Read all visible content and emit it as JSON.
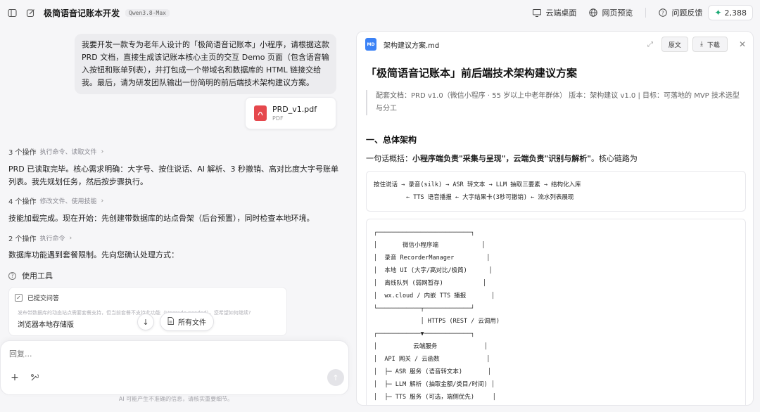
{
  "topbar": {
    "title": "极简语音记账本开发",
    "model": "Qwen3.8-Max",
    "actions": {
      "cloud_desktop": "云端桌面",
      "web_preview": "网页预览",
      "feedback": "问题反馈"
    },
    "credits": "2,388"
  },
  "chat": {
    "user_message": "我要开发一款专为老年人设计的「极简语音记账本」小程序，请根据这款 PRD 文档，直接生成该记账本核心主页的交互 Demo 页面（包含语音输入按钮和账单列表），并打包成一个带域名和数据库的 HTML 链接交给我。最后，请为研发团队输出一份简明的前后端技术架构建议方案。",
    "file": {
      "name": "PRD_v1.pdf",
      "type": "PDF"
    },
    "ops": [
      {
        "count": "3 个操作",
        "desc": "执行命令、读取文件"
      },
      {
        "count": "4 个操作",
        "desc": "修改文件、使用技能"
      },
      {
        "count": "2 个操作",
        "desc": "执行命令"
      }
    ],
    "replies": [
      "PRD 已读取完毕。核心需求明确：大字号、按住说话、AI 解析、3 秒撤销、高对比度大字号账单列表。我先规划任务，然后按步骤执行。",
      "技能加载完成。现在开始：先创建带数据库的站点骨架（后台预置），同时检查本地环境。",
      "数据库功能遇到套餐限制。先向您确认处理方式："
    ],
    "tool_label": "使用工具",
    "submitted": {
      "title": "已提交问答",
      "note": "发布带数据库的动态站点需要套餐支持，但当前套餐不支持此功能（Upgrade needed）。您希望如何继续?",
      "choice": "浏览器本地存储版"
    },
    "all_files": "所有文件",
    "composer_placeholder": "回复...",
    "disclaimer": "AI 可能产生不准确的信息，请核实重要细节。"
  },
  "doc": {
    "filename": "架构建议方案.md",
    "btn_source": "原文",
    "btn_download": "下载",
    "h1": "「极简语音记账本」前后端技术架构建议方案",
    "meta": "配套文档：PRD v1.0（微信小程序 · 55 岁以上中老年群体） 版本：架构建议 v1.0   |   目标：可落地的 MVP 技术选型与分工",
    "h2": "一、总体架构",
    "summary_prefix": "一句话概括：",
    "summary_bold": "小程序端负责\"采集与呈现\"，云端负责\"识别与解析\"",
    "summary_suffix": "。核心链路为",
    "flow": "按住说话 → 录音(silk) → ASR 转文本 → LLM 抽取三要素 → 结构化入库\n         ← TTS 语音播报 ← 大字结果卡(3秒可撤销) ← 流水列表展现",
    "diagram": "┌──────────────────────────┐\n│       微信小程序端            │\n│  录音 RecorderManager         │\n│  本地 UI (大字/高对比/极简)      │\n│  离线队列 (弱网暂存)           │\n│  wx.cloud / 内嵌 TTS 播报       │\n└────────────┬─────────────┘\n             │ HTTPS (REST / 云调用)\n┌────────────▼─────────────┐\n│          云端服务             │\n│  API 网关 / 云函数             │\n│  ├─ ASR 服务 (语音转文本)       │\n│  ├─ LLM 解析 (抽取金额/类目/时间) │\n│  ├─ TTS 服务 (可选，端侧优先)     │"
  }
}
